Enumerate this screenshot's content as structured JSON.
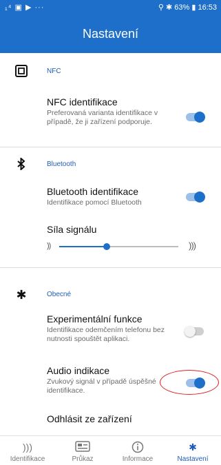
{
  "status_bar": {
    "left_icons": "₁⁴ ▣ ▶ ···",
    "right_text": "63% ▮ 16:53",
    "battery": "63%",
    "time": "16:53"
  },
  "app_bar": {
    "title": "Nastavení"
  },
  "sections": {
    "nfc": {
      "title": "NFC",
      "icon": "nfc-icon",
      "row": {
        "title": "NFC identifikace",
        "subtitle": "Preferovaná varianta identifikace v případě, že ji zařízení podporuje.",
        "enabled": true
      }
    },
    "bluetooth": {
      "title": "Bluetooth",
      "icon": "bluetooth-icon",
      "row": {
        "title": "Bluetooth identifikace",
        "subtitle": "Identifikace pomocí Bluetooth",
        "enabled": true
      },
      "signal": {
        "title": "Síla signálu",
        "level": 0.4
      }
    },
    "general": {
      "title": "Obecné",
      "icon": "gear-icon",
      "experimental": {
        "title": "Experimentální funkce",
        "subtitle": "Identifikace odemčením telefonu bez nutnosti spouštět aplikaci.",
        "enabled": false
      },
      "audio": {
        "title": "Audio indikace",
        "subtitle": "Zvukový signál v případě úspěšné identifikace.",
        "enabled": true
      },
      "logout": {
        "title": "Odhlásit ze zařízení"
      }
    }
  },
  "annotation": {
    "color": "#e02020"
  },
  "bottom_nav": {
    "items": [
      {
        "label": "Identifikace",
        "icon": "signal-icon"
      },
      {
        "label": "Průkaz",
        "icon": "card-icon"
      },
      {
        "label": "Informace",
        "icon": "info-icon"
      },
      {
        "label": "Nastavení",
        "icon": "gear-icon"
      }
    ],
    "active_index": 3
  },
  "colors": {
    "accent": "#1e6fc9",
    "section_title": "#1e5bb8"
  }
}
